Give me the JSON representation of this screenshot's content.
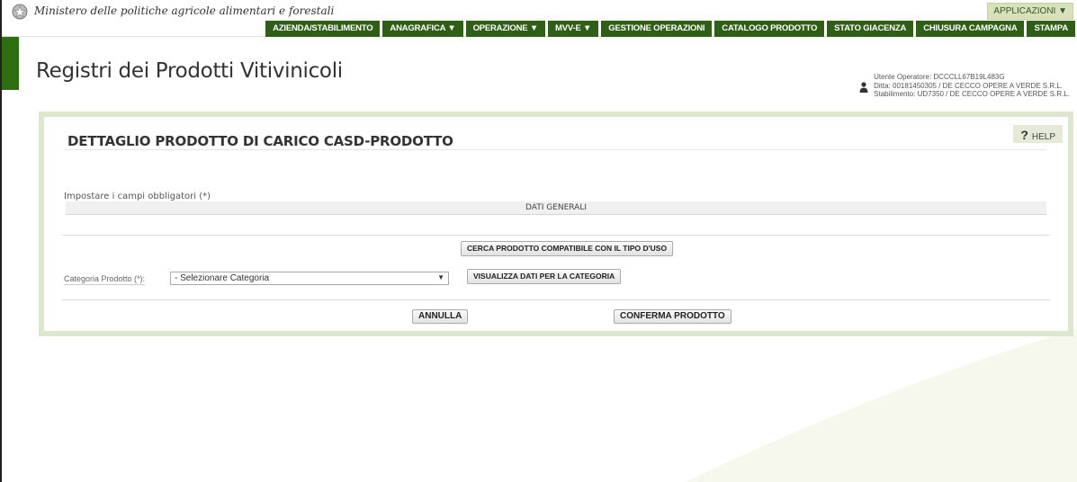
{
  "header": {
    "ministry_name": "Ministero delle politiche agricole alimentari e forestali",
    "apps_label": "APPLICAZIONI ▼",
    "app_title": "Registri dei Prodotti Vitivinicoli"
  },
  "menu": [
    {
      "label": "AZIENDA/STABILIMENTO"
    },
    {
      "label": "ANAGRAFICA ▼"
    },
    {
      "label": "OPERAZIONE ▼"
    },
    {
      "label": "MVV-E ▼"
    },
    {
      "label": "GESTIONE OPERAZIONI"
    },
    {
      "label": "CATALOGO PRODOTTO"
    },
    {
      "label": "STATO GIACENZA"
    },
    {
      "label": "CHIUSURA CAMPAGNA"
    },
    {
      "label": "STAMPA"
    }
  ],
  "user": {
    "operator": "Utente Operatore: DCCCLL67B19L483G",
    "company": "Ditta: 00181450305 / DE CECCO OPERE A VERDE S.R.L.",
    "plant": "Stabilimento: UD7350 / DE CECCO OPERE A VERDE S.R.L."
  },
  "panel": {
    "help_label": "HELP",
    "help_glyph": "?",
    "title": "DETTAGLIO PRODOTTO DI CARICO CASD-PRODOTTO",
    "required_note": "Impostare i campi obbligatori (*)",
    "section_title": "DATI GENERALI",
    "search_button": "CERCA PRODOTTO COMPATIBILE CON IL TIPO D'USO",
    "category_label": "Categoria Prodotto (*):",
    "category_value": "- Selezionare Categoria",
    "category_arrow": "▼",
    "category_button": "VISUALIZZA DATI PER LA CATEGORIA",
    "cancel_button": "ANNULLA",
    "confirm_button": "CONFERMA PRODOTTO"
  },
  "colors": {
    "menu_bg": "#2f5f17",
    "panel_border": "#dde7cd",
    "accent_green": "#2f6e10"
  },
  "icons": [
    "ministry-emblem-icon",
    "user-icon",
    "dropdown-arrow-icon"
  ]
}
